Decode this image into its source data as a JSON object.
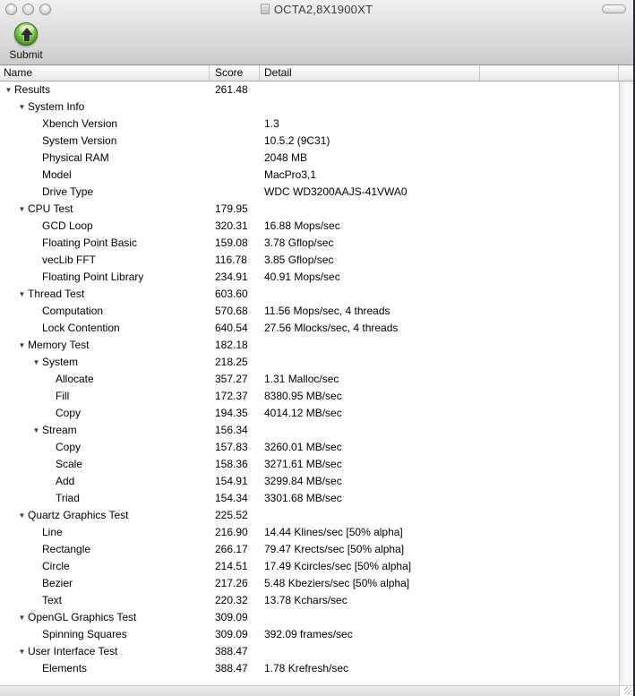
{
  "window": {
    "title": "OCTA2,8X1900XT"
  },
  "toolbar": {
    "submit_label": "Submit"
  },
  "colors": {
    "submit_green": "#4aa422",
    "chrome_gray": "#d2d2d2"
  },
  "table": {
    "columns": [
      "Name",
      "Score",
      "Detail"
    ],
    "rows": [
      {
        "name": "Results",
        "level": 0,
        "disclosure": true,
        "score": "261.48",
        "detail": ""
      },
      {
        "name": "System Info",
        "level": 1,
        "disclosure": true,
        "score": "",
        "detail": ""
      },
      {
        "name": "Xbench Version",
        "level": 2,
        "disclosure": false,
        "score": "",
        "detail": "1.3"
      },
      {
        "name": "System Version",
        "level": 2,
        "disclosure": false,
        "score": "",
        "detail": "10.5.2 (9C31)"
      },
      {
        "name": "Physical RAM",
        "level": 2,
        "disclosure": false,
        "score": "",
        "detail": "2048 MB"
      },
      {
        "name": "Model",
        "level": 2,
        "disclosure": false,
        "score": "",
        "detail": "MacPro3,1"
      },
      {
        "name": "Drive Type",
        "level": 2,
        "disclosure": false,
        "score": "",
        "detail": "WDC WD3200AAJS-41VWA0"
      },
      {
        "name": "CPU Test",
        "level": 1,
        "disclosure": true,
        "score": "179.95",
        "detail": ""
      },
      {
        "name": "GCD Loop",
        "level": 2,
        "disclosure": false,
        "score": "320.31",
        "detail": "16.88 Mops/sec"
      },
      {
        "name": "Floating Point Basic",
        "level": 2,
        "disclosure": false,
        "score": "159.08",
        "detail": "3.78 Gflop/sec"
      },
      {
        "name": "vecLib FFT",
        "level": 2,
        "disclosure": false,
        "score": "116.78",
        "detail": "3.85 Gflop/sec"
      },
      {
        "name": "Floating Point Library",
        "level": 2,
        "disclosure": false,
        "score": "234.91",
        "detail": "40.91 Mops/sec"
      },
      {
        "name": "Thread Test",
        "level": 1,
        "disclosure": true,
        "score": "603.60",
        "detail": ""
      },
      {
        "name": "Computation",
        "level": 2,
        "disclosure": false,
        "score": "570.68",
        "detail": "11.56 Mops/sec, 4 threads"
      },
      {
        "name": "Lock Contention",
        "level": 2,
        "disclosure": false,
        "score": "640.54",
        "detail": "27.56 Mlocks/sec, 4 threads"
      },
      {
        "name": "Memory Test",
        "level": 1,
        "disclosure": true,
        "score": "182.18",
        "detail": ""
      },
      {
        "name": "System",
        "level": 2,
        "disclosure": true,
        "score": "218.25",
        "detail": ""
      },
      {
        "name": "Allocate",
        "level": 3,
        "disclosure": false,
        "score": "357.27",
        "detail": "1.31 Malloc/sec"
      },
      {
        "name": "Fill",
        "level": 3,
        "disclosure": false,
        "score": "172.37",
        "detail": "8380.95 MB/sec"
      },
      {
        "name": "Copy",
        "level": 3,
        "disclosure": false,
        "score": "194.35",
        "detail": "4014.12 MB/sec"
      },
      {
        "name": "Stream",
        "level": 2,
        "disclosure": true,
        "score": "156.34",
        "detail": ""
      },
      {
        "name": "Copy",
        "level": 3,
        "disclosure": false,
        "score": "157.83",
        "detail": "3260.01 MB/sec"
      },
      {
        "name": "Scale",
        "level": 3,
        "disclosure": false,
        "score": "158.36",
        "detail": "3271.61 MB/sec"
      },
      {
        "name": "Add",
        "level": 3,
        "disclosure": false,
        "score": "154.91",
        "detail": "3299.84 MB/sec"
      },
      {
        "name": "Triad",
        "level": 3,
        "disclosure": false,
        "score": "154.34",
        "detail": "3301.68 MB/sec"
      },
      {
        "name": "Quartz Graphics Test",
        "level": 1,
        "disclosure": true,
        "score": "225.52",
        "detail": ""
      },
      {
        "name": "Line",
        "level": 2,
        "disclosure": false,
        "score": "216.90",
        "detail": "14.44 Klines/sec [50% alpha]"
      },
      {
        "name": "Rectangle",
        "level": 2,
        "disclosure": false,
        "score": "266.17",
        "detail": "79.47 Krects/sec [50% alpha]"
      },
      {
        "name": "Circle",
        "level": 2,
        "disclosure": false,
        "score": "214.51",
        "detail": "17.49 Kcircles/sec [50% alpha]"
      },
      {
        "name": "Bezier",
        "level": 2,
        "disclosure": false,
        "score": "217.26",
        "detail": "5.48 Kbeziers/sec [50% alpha]"
      },
      {
        "name": "Text",
        "level": 2,
        "disclosure": false,
        "score": "220.32",
        "detail": "13.78 Kchars/sec"
      },
      {
        "name": "OpenGL Graphics Test",
        "level": 1,
        "disclosure": true,
        "score": "309.09",
        "detail": ""
      },
      {
        "name": "Spinning Squares",
        "level": 2,
        "disclosure": false,
        "score": "309.09",
        "detail": "392.09 frames/sec"
      },
      {
        "name": "User Interface Test",
        "level": 1,
        "disclosure": true,
        "score": "388.47",
        "detail": ""
      },
      {
        "name": "Elements",
        "level": 2,
        "disclosure": false,
        "score": "388.47",
        "detail": "1.78 Krefresh/sec"
      }
    ]
  }
}
